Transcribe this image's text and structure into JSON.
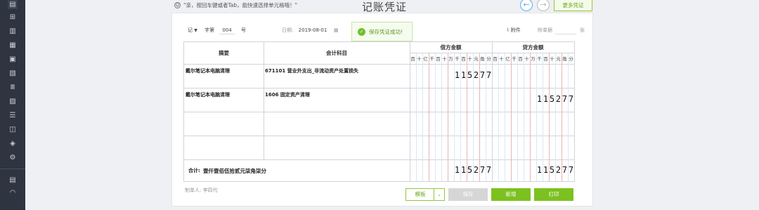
{
  "header": {
    "hint": "\"亲，按回车键或者Tab，能快速选择单元格哦！\"",
    "title": "记账凭证",
    "prev_icon": "arrow-left-icon",
    "next_icon": "arrow-right-icon",
    "more_label": "更多凭证"
  },
  "sidebar": {
    "icons": [
      "home-icon",
      "add-voucher-icon",
      "chart-icon",
      "ledger-icon",
      "calendar-icon",
      "report-icon",
      "bank-icon",
      "invoice-icon",
      "asset-icon",
      "tax-icon",
      "shield-icon",
      "settings-icon",
      "export-icon",
      "dashboard-icon"
    ]
  },
  "voucher": {
    "word_label": "记",
    "word_number_label": "字第",
    "number": "004",
    "number_suffix": "号",
    "date_label": "日期:",
    "date": "2019-08-01",
    "attach_label": "附件",
    "doc_count_label": "附单据",
    "doc_count_unit": "张",
    "toast": "保存凭证成功!"
  },
  "table": {
    "col_summary": "摘要",
    "col_account": "会计科目",
    "col_debit": "借方金额",
    "col_credit": "贷方金额",
    "units": [
      "百",
      "十",
      "亿",
      "千",
      "百",
      "十",
      "万",
      "千",
      "百",
      "十",
      "元",
      "角",
      "分"
    ],
    "rows": [
      {
        "summary": "戴尔笔记本电脑清理",
        "account": "671101 营业外支出_非流动资产处置损失",
        "debit": "115277",
        "credit": ""
      },
      {
        "summary": "戴尔笔记本电脑清理",
        "account": "1606 固定资产清理",
        "debit": "",
        "credit": "115277"
      },
      {
        "summary": "",
        "account": "",
        "debit": "",
        "credit": ""
      },
      {
        "summary": "",
        "account": "",
        "debit": "",
        "credit": ""
      }
    ],
    "total_label": "合计:",
    "total_words": "壹仟壹佰伍拾贰元柒角柒分",
    "total_debit": "115277",
    "total_credit": "115277"
  },
  "footer": {
    "maker_label": "制单人: 李四代",
    "template_label": "模板",
    "save_label": "保存",
    "new_label": "新增",
    "print_label": "打印"
  },
  "colors": {
    "primary_green": "#7cc11f",
    "sidebar_bg": "#2e3440",
    "nav_blue": "#5aaee8"
  }
}
